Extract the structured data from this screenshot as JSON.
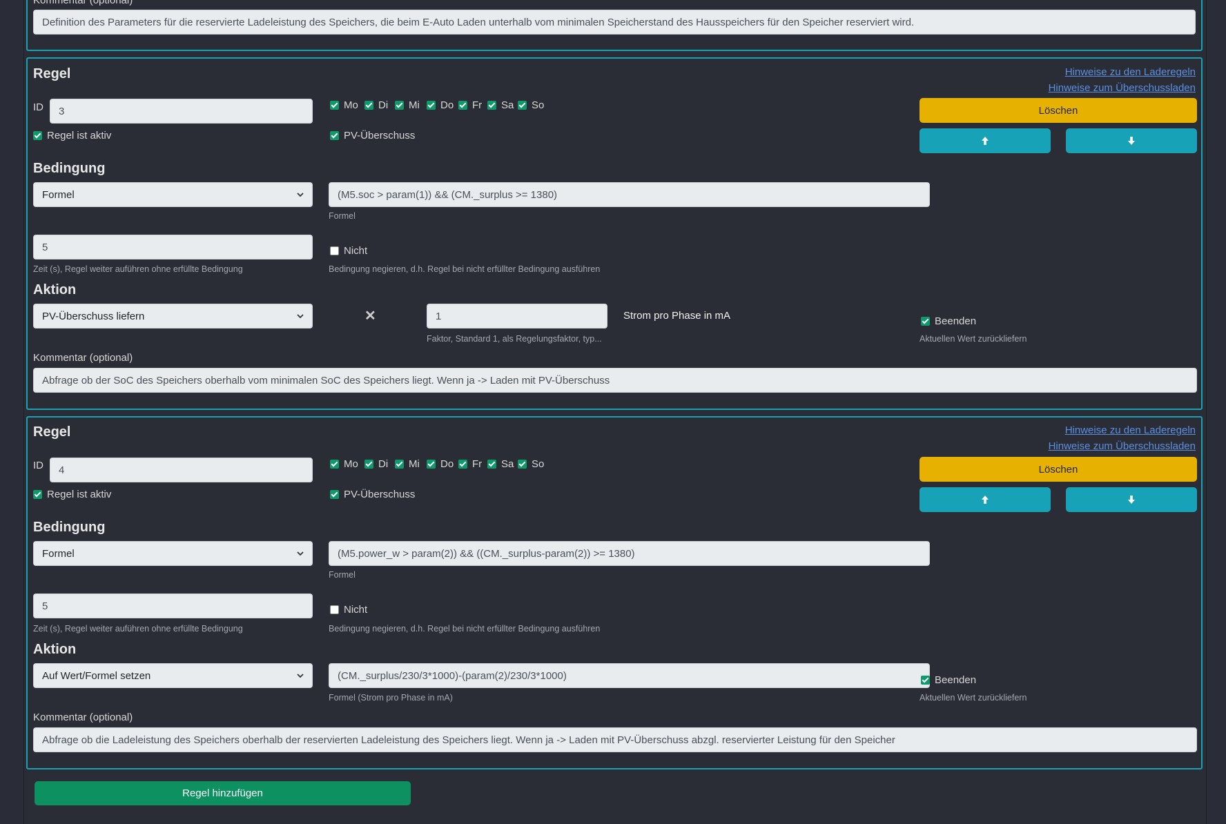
{
  "top": {
    "comment_label": "Kommentar (optional)",
    "comment_value": "Definition des Parameters für die reservierte Ladeleistung des Speichers, die beim E-Auto Laden unterhalb vom minimalen Speicherstand des Hausspeichers für den Speicher reserviert wird."
  },
  "rules": [
    {
      "title": "Regel",
      "link_rules": "Hinweise zu den Laderegeln",
      "link_surplus": "Hinweise zum Überschussladen",
      "id_label": "ID",
      "id_value": "3",
      "days": [
        {
          "label": "Mo",
          "checked": true
        },
        {
          "label": "Di",
          "checked": true
        },
        {
          "label": "Mi",
          "checked": true
        },
        {
          "label": "Do",
          "checked": true
        },
        {
          "label": "Fr",
          "checked": true
        },
        {
          "label": "Sa",
          "checked": true
        },
        {
          "label": "So",
          "checked": true
        }
      ],
      "delete_label": "Löschen",
      "active_label": "Regel ist aktiv",
      "pv_label": "PV-Überschuss",
      "condition_heading": "Bedingung",
      "condition_type": "Formel",
      "condition_formula": "(M5.soc > param(1)) && (CM._surplus >= 1380)",
      "condition_formula_help": "Formel",
      "time_value": "5",
      "time_help": "Zeit (s), Regel weiter auführen ohne erfüllte Bedingung",
      "not_label": "Nicht",
      "not_help": "Bedingung negieren, d.h. Regel bei nicht erfüllter Bedingung ausführen",
      "action_heading": "Aktion",
      "action_type": "PV-Überschuss liefern",
      "factor_value": "1",
      "factor_help": "Faktor, Standard 1, als Regelungsfaktor, typ...",
      "current_label": "Strom pro Phase in mA",
      "end_label": "Beenden",
      "end_help": "Aktuellen Wert zurückliefern",
      "comment_label": "Kommentar (optional)",
      "comment_value": "Abfrage ob der SoC des Speichers oberhalb vom minimalen SoC des Speichers liegt. Wenn ja -> Laden mit PV-Überschuss"
    },
    {
      "title": "Regel",
      "link_rules": "Hinweise zu den Laderegeln",
      "link_surplus": "Hinweise zum Überschussladen",
      "id_label": "ID",
      "id_value": "4",
      "days": [
        {
          "label": "Mo",
          "checked": true
        },
        {
          "label": "Di",
          "checked": true
        },
        {
          "label": "Mi",
          "checked": true
        },
        {
          "label": "Do",
          "checked": true
        },
        {
          "label": "Fr",
          "checked": true
        },
        {
          "label": "Sa",
          "checked": true
        },
        {
          "label": "So",
          "checked": true
        }
      ],
      "delete_label": "Löschen",
      "active_label": "Regel ist aktiv",
      "pv_label": "PV-Überschuss",
      "condition_heading": "Bedingung",
      "condition_type": "Formel",
      "condition_formula": "(M5.power_w > param(2)) && ((CM._surplus-param(2)) >= 1380)",
      "condition_formula_help": "Formel",
      "time_value": "5",
      "time_help": "Zeit (s), Regel weiter auführen ohne erfüllte Bedingung",
      "not_label": "Nicht",
      "not_help": "Bedingung negieren, d.h. Regel bei nicht erfüllter Bedingung ausführen",
      "action_heading": "Aktion",
      "action_type": "Auf Wert/Formel setzen",
      "action_formula": "(CM._surplus/230/3*1000)-(param(2)/230/3*1000)",
      "action_formula_help": "Formel (Strom pro Phase in mA)",
      "end_label": "Beenden",
      "end_help": "Aktuellen Wert zurückliefern",
      "comment_label": "Kommentar (optional)",
      "comment_value": "Abfrage ob die Ladeleistung des Speichers oberhalb der reservierten Ladeleistung des Speichers liegt. Wenn ja -> Laden mit PV-Überschuss abzgl. reservierter Leistung für den Speicher"
    }
  ],
  "add_rule_label": "Regel hinzufügen",
  "colors": {
    "panel_border": "#1aa1b5",
    "delete": "#e6b100",
    "move": "#17a2b8",
    "add": "#0d9160",
    "check": "#0f9a6b"
  },
  "icons": {
    "up": "arrow-up-icon",
    "down": "arrow-down-icon",
    "times": "times-icon",
    "select": "chevron-down-icon"
  }
}
